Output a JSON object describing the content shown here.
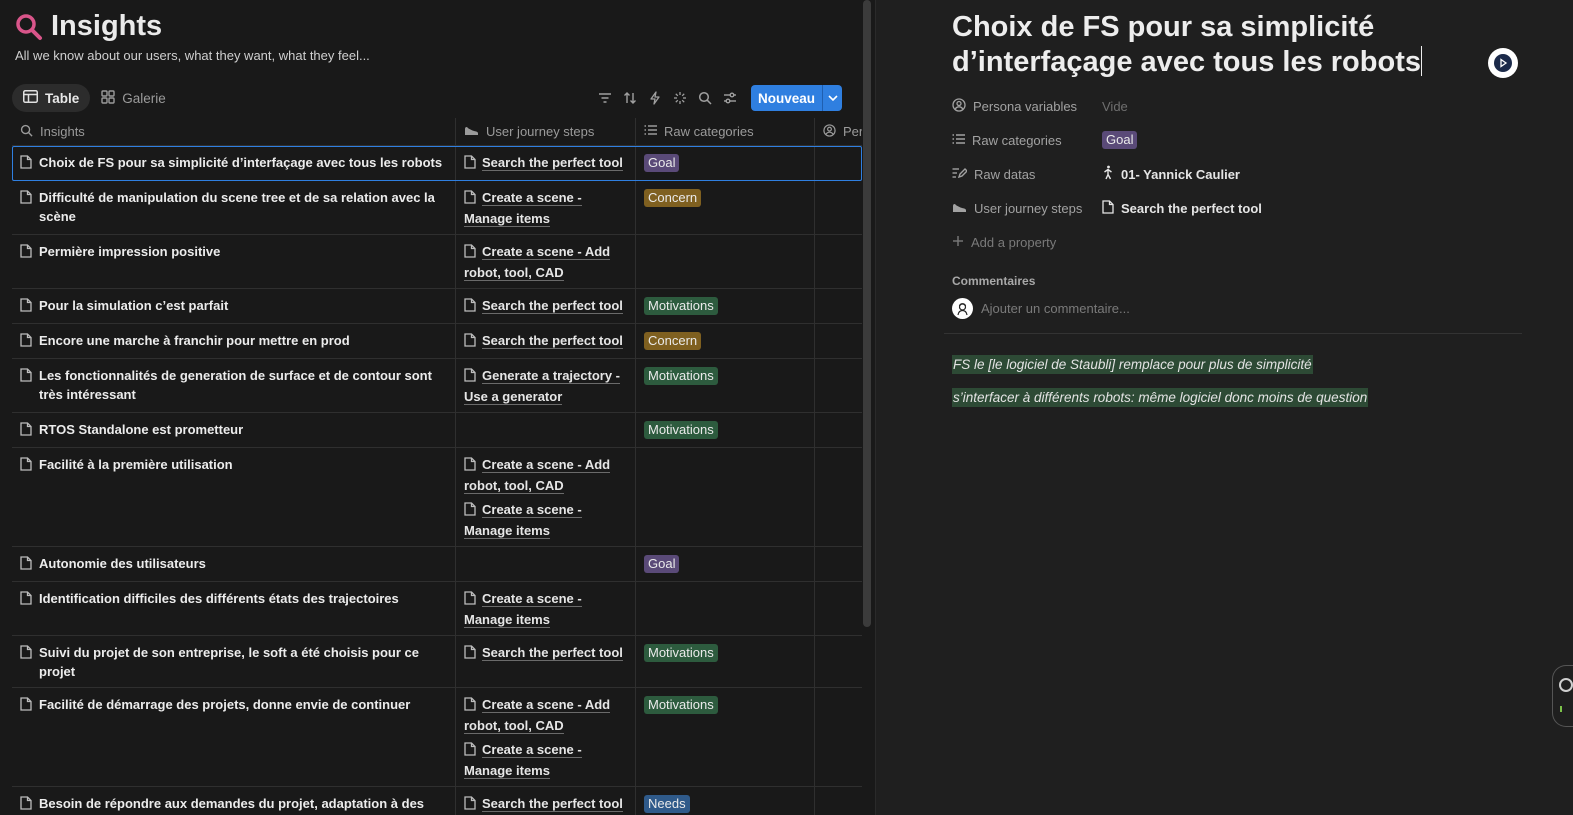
{
  "database": {
    "title": "Insights",
    "subtitle": "All we know about our users, what they want, what they feel...",
    "views": [
      {
        "label": "Table",
        "active": true
      },
      {
        "label": "Galerie",
        "active": false
      }
    ],
    "toolbar": {
      "icons": [
        "filter-icon",
        "sort-icon",
        "automation-icon",
        "ai-sparkle-icon",
        "search-icon",
        "settings-icon"
      ],
      "new_label": "Nouveau"
    },
    "columns": {
      "name": "Insights",
      "journey": "User journey steps",
      "categories": "Raw categories",
      "persona": "Per"
    },
    "rows": [
      {
        "name": "Choix de FS pour sa simplicité d’interfaçage avec tous les robots",
        "steps": [
          "Search the perfect tool"
        ],
        "tag": "Goal",
        "tag_kind": "goal",
        "selected": true
      },
      {
        "name": "Difficulté de manipulation du scene tree et de sa relation avec la scène",
        "steps": [
          "Create a scene - Manage items"
        ],
        "tag": "Concern",
        "tag_kind": "concern"
      },
      {
        "name": "Permière impression positive",
        "steps": [
          "Create a scene - Add robot, tool, CAD"
        ],
        "tag": "",
        "tag_kind": ""
      },
      {
        "name": "Pour la simulation c’est parfait",
        "steps": [
          "Search the perfect tool"
        ],
        "tag": "Motivations",
        "tag_kind": "motiv"
      },
      {
        "name": "Encore une marche à franchir pour mettre en prod",
        "steps": [
          "Search the perfect tool"
        ],
        "tag": "Concern",
        "tag_kind": "concern"
      },
      {
        "name": "Les fonctionnalités de generation de surface et de contour sont très intéressant",
        "steps": [
          "Generate a trajectory - Use a generator"
        ],
        "tag": "Motivations",
        "tag_kind": "motiv"
      },
      {
        "name": "RTOS Standalone est prometteur",
        "steps": [],
        "tag": "Motivations",
        "tag_kind": "motiv"
      },
      {
        "name": "Facilité à la première utilisation",
        "steps": [
          "Create a scene - Add robot, tool, CAD",
          "Create a scene - Manage items"
        ],
        "tag": "",
        "tag_kind": ""
      },
      {
        "name": "Autonomie des utilisateurs",
        "steps": [],
        "tag": "Goal",
        "tag_kind": "goal"
      },
      {
        "name": "Identification difficiles des différents états des trajectoires",
        "steps": [
          "Create a scene - Manage items"
        ],
        "tag": "",
        "tag_kind": ""
      },
      {
        "name": "Suivi du projet de son entreprise, le soft a été choisis pour ce projet",
        "steps": [
          "Search the perfect tool"
        ],
        "tag": "Motivations",
        "tag_kind": "motiv"
      },
      {
        "name": "Facilité de démarrage des projets, donne envie de continuer",
        "steps": [
          "Create a scene - Add robot, tool, CAD",
          "Create a scene - Manage items"
        ],
        "tag": "Motivations",
        "tag_kind": "motiv"
      },
      {
        "name": "Besoin de répondre aux demandes du projet, adaptation à des pièces toutes un peu différentes",
        "steps": [
          "Search the perfect tool"
        ],
        "tag": "Needs",
        "tag_kind": "needs"
      }
    ]
  },
  "detail": {
    "title": "Choix de FS pour sa simplicité d’interfaçage avec tous les robots",
    "properties": {
      "persona": {
        "label": "Persona variables",
        "value": "Vide"
      },
      "categories": {
        "label": "Raw categories",
        "value": "Goal"
      },
      "datas": {
        "label": "Raw datas",
        "value": "01- Yannick Caulier"
      },
      "journey": {
        "label": "User journey steps",
        "value": "Search the perfect tool"
      },
      "add": {
        "label": "Add a property"
      }
    },
    "comments_label": "Commentaires",
    "comment_placeholder": "Ajouter un commentaire...",
    "body": [
      "FS le [le logiciel de Staubli] remplace pour plus de simplicité",
      "s’interfacer à différents robots:  même logiciel donc moins de question"
    ]
  },
  "colors": {
    "accent": "#2f7fe0",
    "title_icon": "#d9558a",
    "goal": "#5a4a78",
    "concern": "#7f6020",
    "motivations": "#2d5b3e",
    "needs": "#2f5a8a",
    "highlight": "#2d4a35"
  }
}
